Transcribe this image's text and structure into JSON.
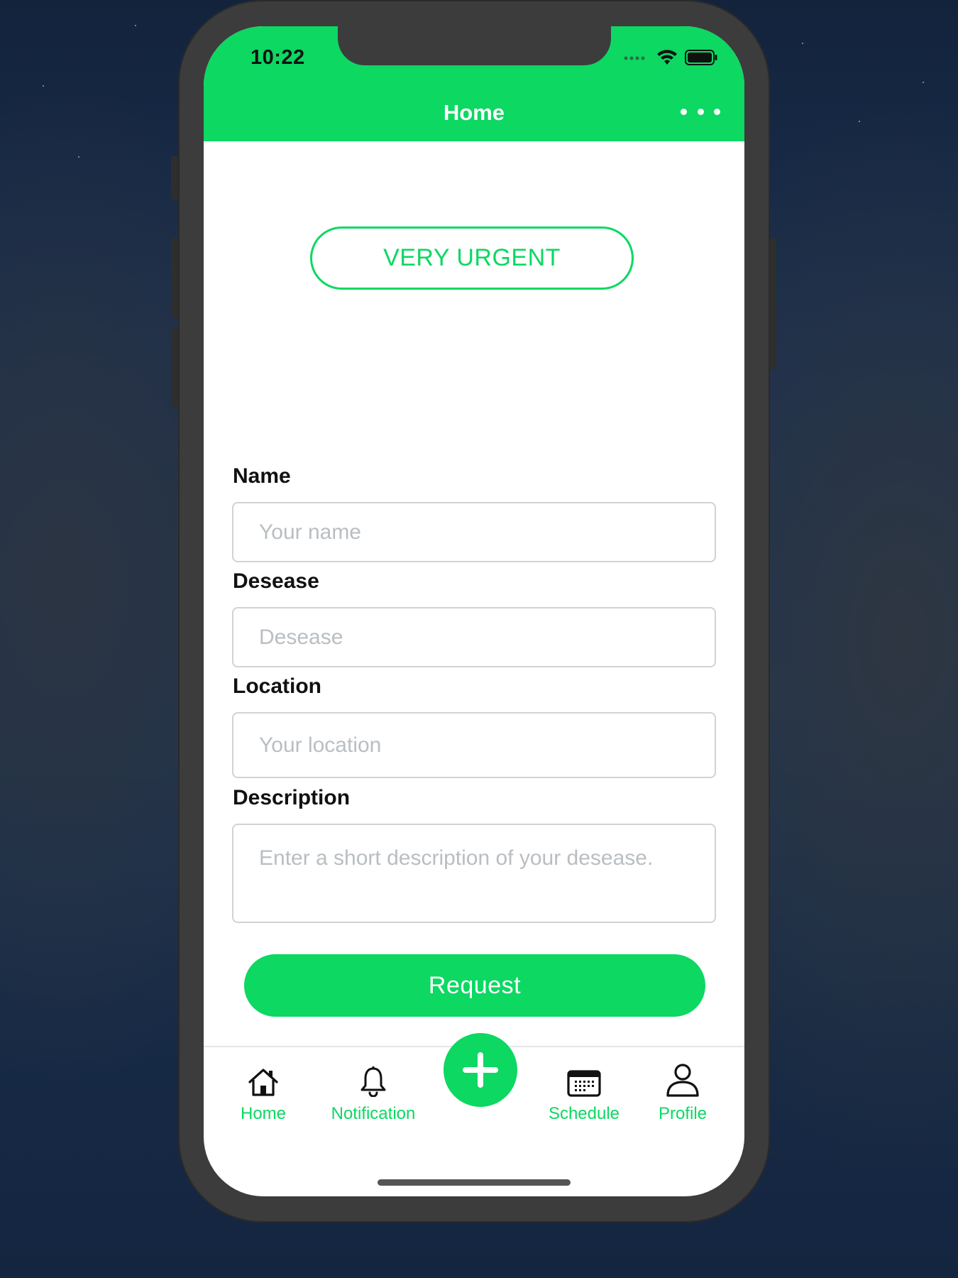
{
  "status_bar": {
    "time": "10:22"
  },
  "header": {
    "title": "Home",
    "more_icon": "ellipsis-icon"
  },
  "urgency": {
    "label": "VERY URGENT"
  },
  "form": {
    "name": {
      "label": "Name",
      "placeholder": "Your name",
      "value": ""
    },
    "disease": {
      "label": "Desease",
      "placeholder": "Desease",
      "value": ""
    },
    "location": {
      "label": "Location",
      "placeholder": "Your location",
      "value": ""
    },
    "description": {
      "label": "Description",
      "placeholder": "Enter a short description of your desease.",
      "value": ""
    },
    "submit_label": "Request"
  },
  "tabbar": {
    "items": [
      {
        "label": "Home",
        "icon": "home-icon"
      },
      {
        "label": "Notification",
        "icon": "bell-icon"
      },
      {
        "label": "",
        "icon": "plus-icon"
      },
      {
        "label": "Schedule",
        "icon": "calendar-icon"
      },
      {
        "label": "Profile",
        "icon": "user-icon"
      }
    ]
  },
  "colors": {
    "accent": "#0cd862",
    "text": "#111111",
    "placeholder": "#b9bec2",
    "border": "#cfd3d6"
  }
}
